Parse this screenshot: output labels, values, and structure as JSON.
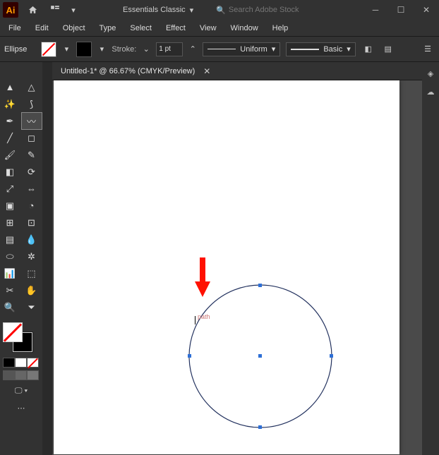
{
  "app": {
    "name": "Ai",
    "workspace": "Essentials Classic",
    "search_placeholder": "Search Adobe Stock"
  },
  "menu": {
    "file": "File",
    "edit": "Edit",
    "object": "Object",
    "type": "Type",
    "select": "Select",
    "effect": "Effect",
    "view": "View",
    "window": "Window",
    "help": "Help"
  },
  "control": {
    "tool": "Ellipse",
    "stroke_label": "Stroke:",
    "stroke_value": "1 pt",
    "vsp": "Uniform",
    "brush": "Basic"
  },
  "tab": {
    "title": "Untitled-1* @ 66.67% (CMYK/Preview)"
  },
  "canvas": {
    "hint": "path"
  },
  "tool_icons": [
    "▲",
    "△",
    "✏",
    "🖊",
    "⬭",
    "⃝",
    "✎",
    "✂",
    "✒",
    "⟲",
    "⌒",
    "🖌",
    "⚙",
    "⇪",
    "🔍",
    "□",
    "◻",
    "◨",
    "☰",
    "📊",
    "⬚",
    "/",
    "✋",
    "🔍"
  ],
  "bot_tools": [
    "⬜",
    "◧",
    "⟲",
    "◐",
    "⬌",
    "⬜ □",
    "⋯"
  ]
}
